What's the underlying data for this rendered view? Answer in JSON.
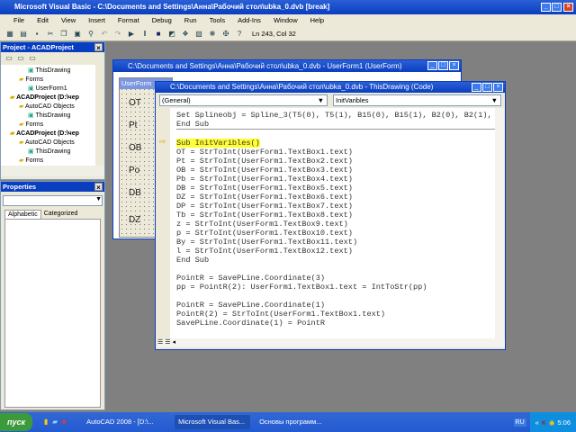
{
  "app": {
    "title": "Microsoft Visual Basic - C:\\Documents and Settings\\Анна\\Рабочий стол\\ubka_0.dvb [break]"
  },
  "menu": [
    "File",
    "Edit",
    "View",
    "Insert",
    "Format",
    "Debug",
    "Run",
    "Tools",
    "Add-Ins",
    "Window",
    "Help"
  ],
  "toolbar": {
    "position": "Ln 243, Col 32"
  },
  "project": {
    "title": "Project - ACADProject",
    "tree": [
      {
        "label": "ThisDrawing",
        "indent": 3
      },
      {
        "label": "Forms",
        "indent": 2
      },
      {
        "label": "UserForm1",
        "indent": 3
      },
      {
        "label": "ACADProject (D:\\чер",
        "indent": 1
      },
      {
        "label": "AutoCAD Objects",
        "indent": 2
      },
      {
        "label": "ThisDrawing",
        "indent": 3
      },
      {
        "label": "Forms",
        "indent": 2
      },
      {
        "label": "ACADProject (D:\\чер",
        "indent": 1
      },
      {
        "label": "AutoCAD Objects",
        "indent": 2
      },
      {
        "label": "ThisDrawing",
        "indent": 3
      },
      {
        "label": "Forms",
        "indent": 2
      }
    ]
  },
  "properties": {
    "title": "Properties",
    "tabs": [
      "Alphabetic",
      "Categorized"
    ]
  },
  "userform": {
    "title": "C:\\Documents and Settings\\Анна\\Рабочий стол\\ubka_0.dvb - UserForm1 (UserForm)",
    "form_caption": "UserForm",
    "labels": [
      "OT",
      "Pt",
      "OB",
      "Po",
      "DB",
      "DZ"
    ]
  },
  "codewin": {
    "title": "C:\\Documents and Settings\\Анна\\Рабочий стол\\ubka_0.dvb - ThisDrawing (Code)",
    "object": "(General)",
    "procedure": "InitVaribles",
    "lines": [
      "Set Splineobj = Spline_3(T5(0), T5(1), B15(0), B15(1), B2(0), B2(1), 0,",
      "End Sub",
      "",
      "Sub InitVaribles()",
      "OT = StrToInt(UserForm1.TextBox1.text)",
      "Pt = StrToInt(UserForm1.TextBox2.text)",
      "OB = StrToInt(UserForm1.TextBox3.text)",
      "Pb = StrToInt(UserForm1.TextBox4.text)",
      "DB = StrToInt(UserForm1.TextBox5.text)",
      "DZ = StrToInt(UserForm1.TextBox6.text)",
      "DP = StrToInt(UserForm1.TextBox7.text)",
      "Tb = StrToInt(UserForm1.TextBox8.text)",
      "z = StrToInt(UserForm1.TextBox9.text)",
      "p = StrToInt(UserForm1.TextBox10.text)",
      "By = StrToInt(UserForm1.TextBox11.text)",
      "l = StrToInt(UserForm1.TextBox12.text)",
      "End Sub",
      "",
      "PointR = SavePLine.Coordinate(3)",
      "pp = PointR(2): UserForm1.TextBox1.text = IntToStr(pp)",
      "",
      "PointR = SavePLine.Coordinate(1)",
      "PointR(2) = StrToInt(UserForm1.TextBox1.text)",
      "SavePLine.Coordinate(1) = PointR"
    ]
  },
  "taskbar": {
    "start": "пуск",
    "items": [
      "AutoCAD 2008 - [D:\\...",
      "Microsoft Visual Bas...",
      "Основы программ..."
    ],
    "lang": "RU",
    "clock": "5:06"
  }
}
